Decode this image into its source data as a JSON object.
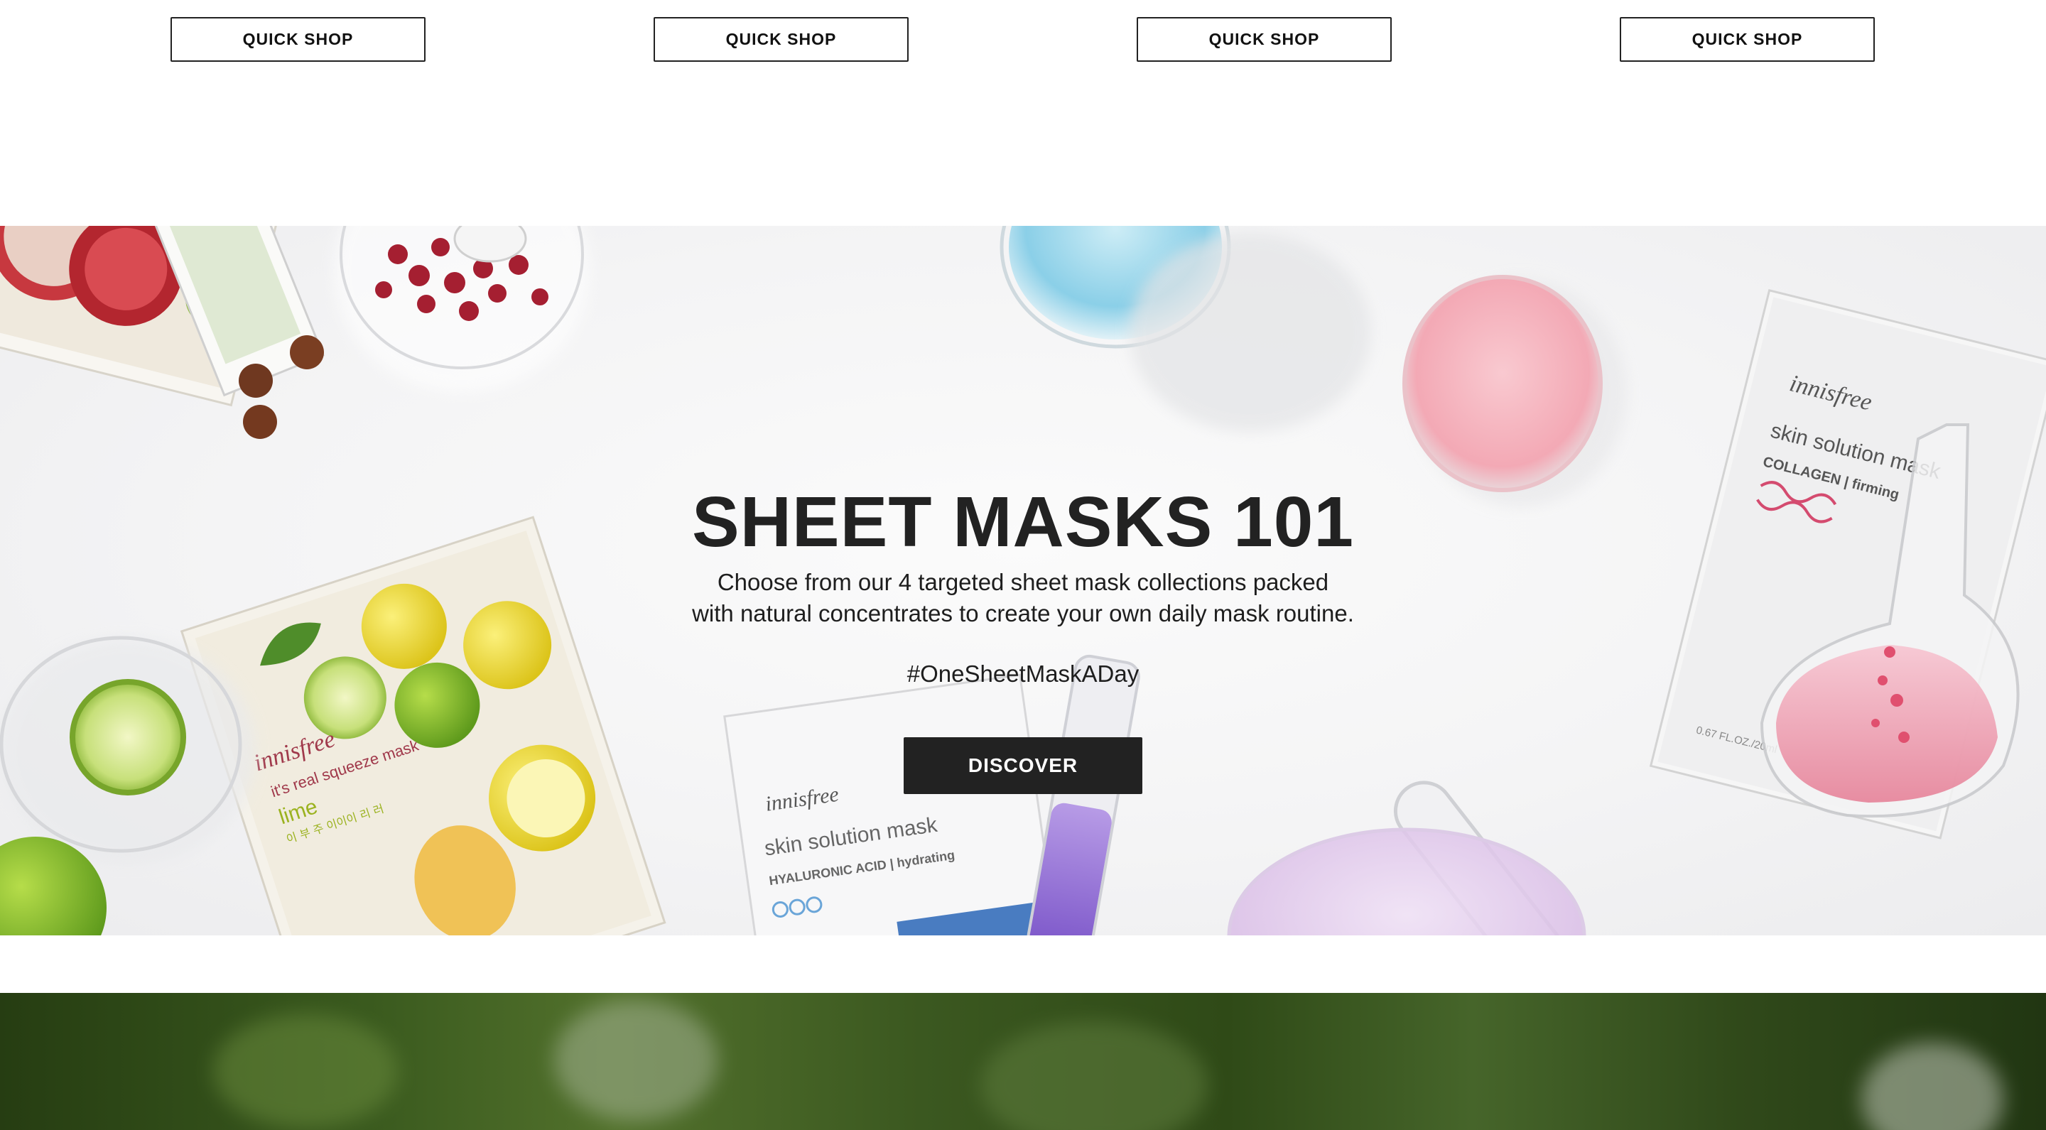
{
  "quick_shop": {
    "buttons": [
      "QUICK SHOP",
      "QUICK SHOP",
      "QUICK SHOP",
      "QUICK SHOP"
    ]
  },
  "hero": {
    "title": "SHEET MASKS 101",
    "subtitle_line1": "Choose from our 4 targeted sheet mask collections packed",
    "subtitle_line2": "with natural concentrates to create your own daily mask routine.",
    "hashtag": "#OneSheetMaskADay",
    "cta_label": "DISCOVER",
    "packs": {
      "lime": {
        "brand": "innisfree",
        "line": "it's real squeeze mask",
        "variant": "lime",
        "korean": "이 부 주 이이이 리 러"
      },
      "hyaluronic": {
        "brand": "innisfree",
        "line": "skin solution mask",
        "variant": "HYALURONIC ACID | hydrating"
      },
      "collagen": {
        "brand": "innisfree",
        "line": "skin solution mask",
        "variant": "COLLAGEN | firming",
        "volume": "0.67 FL.OZ./20ml"
      }
    }
  },
  "colors": {
    "button_dark": "#222222",
    "text": "#222222",
    "hero_bg": "#f4f4f5",
    "green_banner": "#3a5a1e"
  },
  "icons": {
    "hero_image": "sheet-masks-still-life-image"
  }
}
